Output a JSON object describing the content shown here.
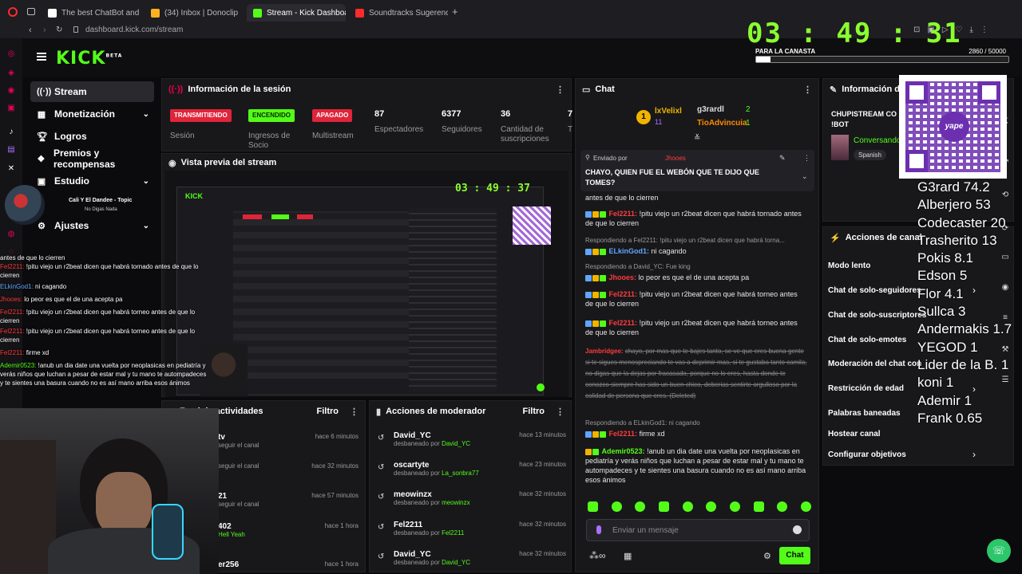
{
  "browser": {
    "tabs": [
      {
        "title": "The best ChatBot and Wo",
        "color": "#ffffff"
      },
      {
        "title": "(34) Inbox | Donoclip",
        "color": "#ffb020"
      },
      {
        "title": "Stream - Kick Dashboard",
        "color": "#53fc18"
      },
      {
        "title": "Soundtracks Sugerencias",
        "color": "#ff2a2a"
      }
    ],
    "new_tab": "+",
    "url": "dashboard.kick.com/stream"
  },
  "timer": "03 : 49 : 31",
  "goal": {
    "label": "PARA LA CANASTA",
    "count": "2860 / 50000",
    "progress": 0.057
  },
  "header": {
    "logo": "KICK",
    "logo_sup": "BETA"
  },
  "nav": [
    {
      "label": "Stream",
      "icon": "stream-icon",
      "chev": ""
    },
    {
      "label": "Monetización",
      "icon": "money-icon",
      "chev": "⌄"
    },
    {
      "label": "Logros",
      "icon": "trophy-icon",
      "chev": ""
    },
    {
      "label": "Premios y recompensas",
      "icon": "gift-icon",
      "chev": ""
    },
    {
      "label": "Estudio",
      "icon": "studio-icon",
      "chev": "⌄"
    },
    {
      "label": "Ajustes",
      "icon": "settings-icon",
      "chev": "⌄"
    }
  ],
  "music": {
    "title": "Cali Y El Dandee - Topic",
    "subtitle": "No Digas Nada"
  },
  "session": {
    "title": "Información de la sesión",
    "dots": "⋮",
    "items": [
      {
        "badge": "TRANSMITIENDO",
        "label": "Sesión",
        "bg": "#e0243a",
        "fg": "#ffffff"
      },
      {
        "badge": "ENCENDIDO",
        "label": "Ingresos de Socio",
        "bg": "#53fc18",
        "fg": "#062b00"
      },
      {
        "badge": "APAGADO",
        "label": "Multistream",
        "bg": "#e0243a",
        "fg": "#ffffff"
      }
    ],
    "stats": [
      {
        "value": "87",
        "label": "Espectadores"
      },
      {
        "value": "6377",
        "label": "Seguidores"
      },
      {
        "value": "36",
        "label": "Cantidad de suscripciones"
      },
      {
        "value": "7",
        "label": "T"
      }
    ]
  },
  "preview": {
    "title": "Vista previa del stream",
    "timer": "03 : 49 : 37"
  },
  "activity": {
    "title": "Feed de actividades",
    "filter": "Filtro",
    "dots": "⋮",
    "rows": [
      {
        "name": "tv",
        "sub": "seguir el canal",
        "time": "hace 6 minutos"
      },
      {
        "name": "",
        "sub": "seguir el canal",
        "time": "hace 32 minutos"
      },
      {
        "name": "21",
        "sub": "seguir el canal",
        "time": "hace 57 minutos"
      },
      {
        "name": "402",
        "sub": "Hell Yeah",
        "time": "hace 1 hora"
      },
      {
        "name": "er256",
        "sub": "",
        "time": "hace 1 hora"
      }
    ]
  },
  "moderator": {
    "title": "Acciones de moderador",
    "filter": "Filtro",
    "dots": "⋮",
    "rows": [
      {
        "name": "David_YC",
        "action": "desbaneado por",
        "by": "David_YC",
        "time": "hace 13 minutos"
      },
      {
        "name": "oscartyte",
        "action": "desbaneado por",
        "by": "La_sonbra77",
        "time": "hace 23 minutos"
      },
      {
        "name": "meowinzx",
        "action": "desbaneado por",
        "by": "meowinzx",
        "time": "hace 32 minutos"
      },
      {
        "name": "Fel2211",
        "action": "desbaneado por",
        "by": "Fel2211",
        "time": "hace 32 minutos"
      },
      {
        "name": "David_YC",
        "action": "desbaneado por",
        "by": "David_YC",
        "time": "hace 32 minutos"
      }
    ]
  },
  "chat": {
    "title": "Chat",
    "dots": "⋮",
    "top": [
      {
        "rank": "1",
        "name": "lxVelixl",
        "count": "11"
      },
      {
        "name": "g3rardl",
        "count": "2"
      },
      {
        "name": "TioAdvincuia",
        "count": "1"
      }
    ],
    "pinned": {
      "label": "Enviado por",
      "user": "Jhooes",
      "text": "CHAYO, QUIEN FUE EL WEBÓN QUE TE DIJO QUE TOMES?"
    },
    "messages": [
      {
        "reply": "",
        "user": "",
        "cls": "",
        "text": "antes de que lo cierren"
      },
      {
        "reply": "",
        "user": "Fel2211:",
        "cls": "",
        "text": "!pitu viejo un r2beat dicen que habrá tornado antes de que lo cierren"
      },
      {
        "reply": "Respondiendo a Fel2211: !pitu viejo un r2beat dicen que habrá torna...",
        "user": "ELkinGod1:",
        "cls": "b",
        "text": "ni cagando"
      },
      {
        "reply": "Respondiendo a David_YC: Fue king",
        "user": "Jhooes:",
        "cls": "",
        "text": "lo peor es que el de una acepta pa"
      },
      {
        "reply": "",
        "user": "Fel2211:",
        "cls": "",
        "text": "!pitu viejo un r2beat dicen que habrá torneo antes de que lo cierren"
      },
      {
        "reply": "",
        "user": "Fel2211:",
        "cls": "",
        "text": "!pitu viejo un r2beat dicen que habrá torneo antes de que lo cierren"
      },
      {
        "reply": "",
        "user": "Jambridgee:",
        "cls": "",
        "text": "chayo, por mas que te bajes tanto, se ve que eres buena gente si te sigues menospreciando te vas a deprimir mas, si te gustaba tanto camila, no digas que la dejas por fracasado, porque no lo eres, hasta donde te conozco siempre has sido un buen chico, deberias sentirte orgulloso por la calidad de persona que eres. (Deleted)"
      },
      {
        "reply": "Respondiendo a ELkinGod1: ni cagando",
        "user": "Fel2211:",
        "cls": "",
        "text": "firme xd"
      },
      {
        "reply": "",
        "user": "Ademir0523:",
        "cls": "g",
        "text": "!anub un dia date una vuelta por neoplasicas en pediatría y verás niños que luchan a pesar de estar mal y tu mano te autompadeces y te sientes una basura cuando no es así mano arriba esos ánimos"
      }
    ],
    "input_placeholder": "Enviar un mensaje",
    "send": "Chat"
  },
  "info_panel": {
    "title": "Información del stream",
    "stream_title": "CHUPISTREAM CO !BOT",
    "category": "Conversando",
    "tag": "Spanish"
  },
  "channel_actions": {
    "title": "Acciones de canal",
    "items": [
      "Modo lento",
      "Chat de solo-seguidores",
      "Chat de solo-suscriptores",
      "Chat de solo-emotes",
      "Moderación del chat con",
      "Restricción de edad",
      "Palabras baneadas",
      "Hostear canal",
      "Configurar objetivos"
    ]
  },
  "leaderboard": [
    "G3rard 74.2",
    "Alberjero 53",
    "Codecaster 20",
    "Trasherito 13",
    "Pokis 8.1",
    "Edson 5",
    "Flor 4.1",
    "Sullca 3",
    "Andermakis 1.7",
    "YEGOD 1",
    "Lider de la B. 1",
    "koni 1",
    "Ademir 1",
    "Frank 0.65"
  ],
  "left_feed": [
    {
      "user": "",
      "cls": "",
      "text": "antes de que lo cierren"
    },
    {
      "user": "Fel2211:",
      "cls": "",
      "text": "!pitu viejo un r2beat dicen que habrá tornado antes de que lo cierren"
    },
    {
      "user": "ELkinGod1:",
      "cls": "b",
      "text": "ni cagando"
    },
    {
      "user": "Jhooes:",
      "cls": "",
      "text": "lo peor es que el de una acepta pa"
    },
    {
      "user": "Fel2211:",
      "cls": "",
      "text": "!pitu viejo un r2beat dicen que habrá torneo antes de que lo cierren"
    },
    {
      "user": "Fel2211:",
      "cls": "",
      "text": "!pitu viejo un r2beat dicen que habrá torneo antes de que lo cierren"
    },
    {
      "user": "Fel2211:",
      "cls": "",
      "text": "firme xd"
    },
    {
      "user": "Ademir0523:",
      "cls": "g",
      "text": "!anub un dia date una vuelta por neoplasicas en pediatría y verás niños que luchan a pesar de estar mal y tu mano te autompadeces y te sientes una basura cuando no es así mano arriba esos ánimos"
    }
  ],
  "qr_label": "yape"
}
